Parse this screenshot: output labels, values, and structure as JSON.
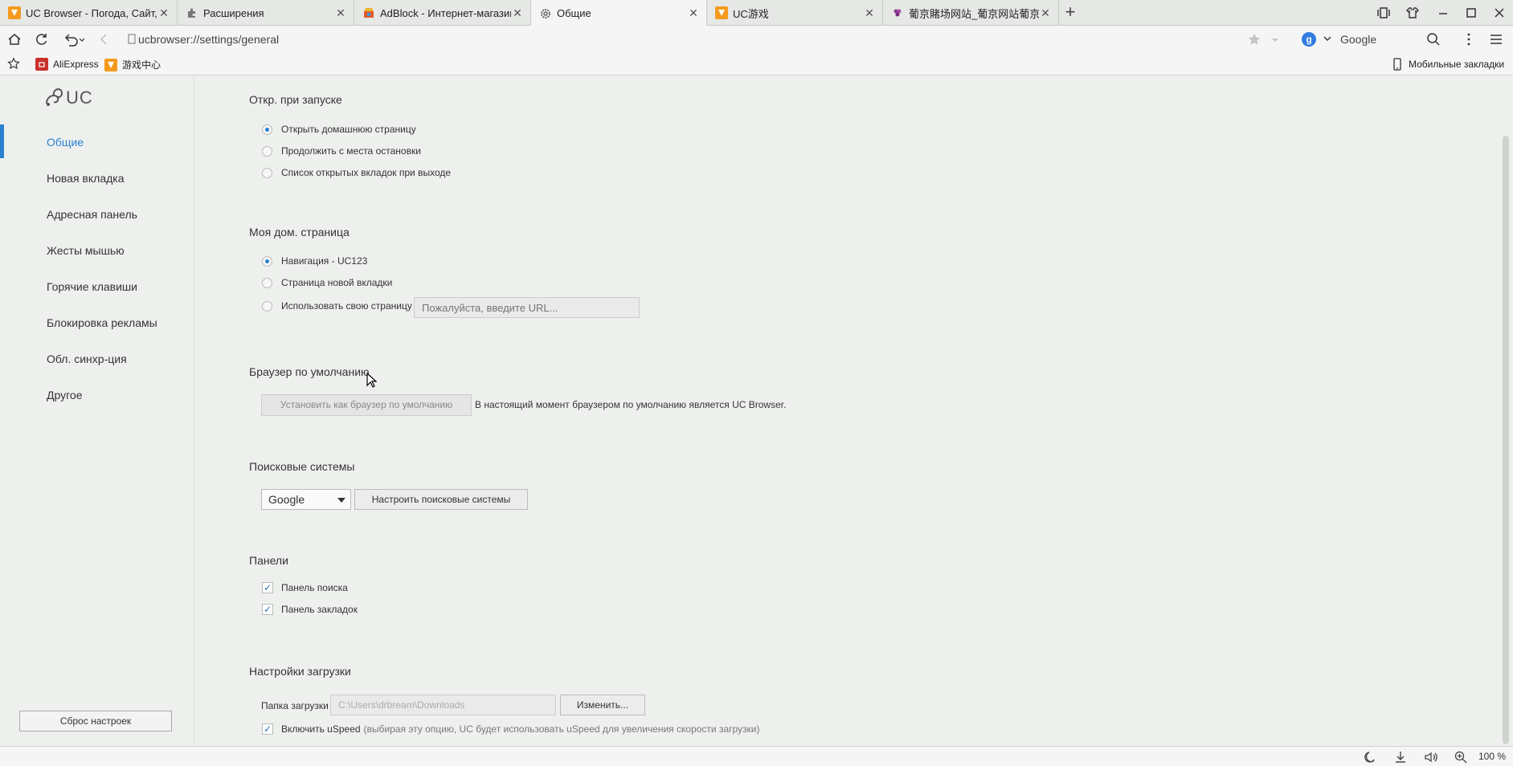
{
  "tabs": [
    {
      "title": "UC Browser - Погода, Сайт, Н",
      "favicon": "uc-logo-icon",
      "active": false
    },
    {
      "title": "Расширения",
      "favicon": "puzzle-icon",
      "active": false
    },
    {
      "title": "AdBlock - Интернет-магазин",
      "favicon": "webstore-icon",
      "active": false
    },
    {
      "title": "Общие",
      "favicon": "gear-icon",
      "active": true
    },
    {
      "title": "UC游戏",
      "favicon": "uc-logo-icon",
      "active": false
    },
    {
      "title": "葡京賭场网站_葡京网站葡京_",
      "favicon": "grape-icon",
      "active": false
    }
  ],
  "address_bar": {
    "url": "ucbrowser://settings/general"
  },
  "search": {
    "engine": "Google"
  },
  "bookmarks": [
    {
      "label": "AliExpress",
      "favicon": "aliexpress-icon"
    },
    {
      "label": "游戏中心",
      "favicon": "uc-logo-icon"
    }
  ],
  "mobile_bookmarks_label": "Мобильные закладки",
  "sidebar": {
    "brand": "UC",
    "items": [
      {
        "label": "Общие",
        "active": true
      },
      {
        "label": "Новая вкладка",
        "active": false
      },
      {
        "label": "Адресная панель",
        "active": false
      },
      {
        "label": "Жесты мышью",
        "active": false
      },
      {
        "label": "Горячие клавиши",
        "active": false
      },
      {
        "label": "Блокировка рекламы",
        "active": false
      },
      {
        "label": "Обл. синхр-ция",
        "active": false
      },
      {
        "label": "Другое",
        "active": false
      }
    ],
    "reset_label": "Сброс настроек"
  },
  "sections": {
    "startup": {
      "title": "Откр. при запуске",
      "options": [
        {
          "label": "Открыть домашнюю страницу",
          "selected": true
        },
        {
          "label": "Продолжить с места остановки",
          "selected": false
        },
        {
          "label": "Список открытых вкладок при выходе",
          "selected": false
        }
      ]
    },
    "homepage": {
      "title": "Моя дом. страница",
      "options": [
        {
          "label": "Навигация - UC123",
          "selected": true
        },
        {
          "label": "Страница новой вкладки",
          "selected": false
        },
        {
          "label": "Использовать свою страницу",
          "selected": false
        }
      ],
      "url_placeholder": "Пожалуйста, введите URL..."
    },
    "default_browser": {
      "title": "Браузер по умолчанию",
      "button": "Установить как браузер по умолчанию",
      "status": "В настоящий момент браузером по умолчанию является UC Browser."
    },
    "search_engines": {
      "title": "Поисковые системы",
      "selected": "Google",
      "configure_button": "Настроить поисковые системы"
    },
    "panels": {
      "title": "Панели",
      "options": [
        {
          "label": "Панель поиска",
          "checked": true
        },
        {
          "label": "Панель закладок",
          "checked": true
        }
      ]
    },
    "downloads": {
      "title": "Настройки загрузки",
      "folder_label": "Папка загрузки",
      "folder_path": "C:\\Users\\drbream\\Downloads",
      "change_button": "Изменить...",
      "uspeed_label": "Включить uSpeed",
      "uspeed_hint": "(выбирая эту опцию, UC будет использовать uSpeed для увеличения скорости загрузки)",
      "uspeed_checked": true
    }
  },
  "status_bar": {
    "zoom": "100 %"
  },
  "colors": {
    "accent": "#2a82d0",
    "uc_orange": "#f39a1d",
    "background": "#eef0ee"
  }
}
